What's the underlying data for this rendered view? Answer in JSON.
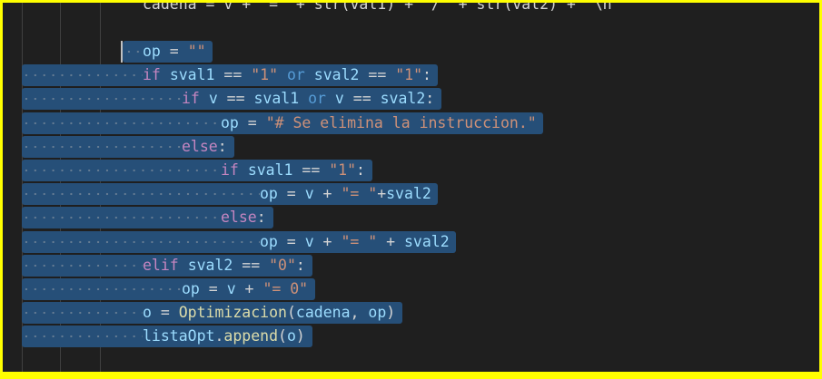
{
  "editor": {
    "top_partial": "cadena = v + \"=\" + str(val1) + \"/\" + str(val2) + \"\\n\"",
    "lines": [
      {
        "indent": 0,
        "tokens": [
          [
            "var",
            "op"
          ],
          [
            "plain",
            " = "
          ],
          [
            "str",
            "\"\""
          ]
        ]
      },
      {
        "indent": 0,
        "tokens": [
          [
            "kw-ctrl",
            "if"
          ],
          [
            "plain",
            " "
          ],
          [
            "var",
            "sval1"
          ],
          [
            "plain",
            " == "
          ],
          [
            "str",
            "\"1\""
          ],
          [
            "plain",
            " "
          ],
          [
            "kw-op",
            "or"
          ],
          [
            "plain",
            " "
          ],
          [
            "var",
            "sval2"
          ],
          [
            "plain",
            " == "
          ],
          [
            "str",
            "\"1\""
          ],
          [
            "plain",
            ":"
          ]
        ]
      },
      {
        "indent": 1,
        "tokens": [
          [
            "kw-ctrl",
            "if"
          ],
          [
            "plain",
            " "
          ],
          [
            "var",
            "v"
          ],
          [
            "plain",
            " == "
          ],
          [
            "var",
            "sval1"
          ],
          [
            "plain",
            " "
          ],
          [
            "kw-op",
            "or"
          ],
          [
            "plain",
            " "
          ],
          [
            "var",
            "v"
          ],
          [
            "plain",
            " == "
          ],
          [
            "var",
            "sval2"
          ],
          [
            "plain",
            ":"
          ]
        ]
      },
      {
        "indent": 2,
        "tokens": [
          [
            "var",
            "op"
          ],
          [
            "plain",
            " = "
          ],
          [
            "str",
            "\"# Se elimina la instruccion.\""
          ]
        ]
      },
      {
        "indent": 1,
        "tokens": [
          [
            "kw-ctrl",
            "else"
          ],
          [
            "plain",
            ":"
          ]
        ]
      },
      {
        "indent": 2,
        "tokens": [
          [
            "kw-ctrl",
            "if"
          ],
          [
            "plain",
            " "
          ],
          [
            "var",
            "sval1"
          ],
          [
            "plain",
            " == "
          ],
          [
            "str",
            "\"1\""
          ],
          [
            "plain",
            ":"
          ]
        ]
      },
      {
        "indent": 3,
        "tokens": [
          [
            "var",
            "op"
          ],
          [
            "plain",
            " = "
          ],
          [
            "var",
            "v"
          ],
          [
            "plain",
            " + "
          ],
          [
            "str",
            "\"= \""
          ],
          [
            "plain",
            "+"
          ],
          [
            "var",
            "sval2"
          ]
        ]
      },
      {
        "indent": 2,
        "tokens": [
          [
            "kw-ctrl",
            "else"
          ],
          [
            "plain",
            ":"
          ]
        ]
      },
      {
        "indent": 3,
        "tokens": [
          [
            "var",
            "op"
          ],
          [
            "plain",
            " = "
          ],
          [
            "var",
            "v"
          ],
          [
            "plain",
            " + "
          ],
          [
            "str",
            "\"= \""
          ],
          [
            "plain",
            " + "
          ],
          [
            "var",
            "sval2"
          ]
        ]
      },
      {
        "indent": 0,
        "tokens": [
          [
            "kw-ctrl",
            "elif"
          ],
          [
            "plain",
            " "
          ],
          [
            "var",
            "sval2"
          ],
          [
            "plain",
            " == "
          ],
          [
            "str",
            "\"0\""
          ],
          [
            "plain",
            ":"
          ]
        ]
      },
      {
        "indent": 1,
        "tokens": [
          [
            "var",
            "op"
          ],
          [
            "plain",
            " = "
          ],
          [
            "var",
            "v"
          ],
          [
            "plain",
            " + "
          ],
          [
            "str",
            "\"= 0\""
          ]
        ]
      },
      {
        "indent": 0,
        "tokens": [
          [
            "var",
            "o"
          ],
          [
            "plain",
            " = "
          ],
          [
            "fn",
            "Optimizacion"
          ],
          [
            "plain",
            "("
          ],
          [
            "var",
            "cadena"
          ],
          [
            "plain",
            ", "
          ],
          [
            "var",
            "op"
          ],
          [
            "plain",
            ")"
          ]
        ]
      },
      {
        "indent": 0,
        "tokens": [
          [
            "var",
            "listaOpt"
          ],
          [
            "plain",
            "."
          ],
          [
            "fn",
            "append"
          ],
          [
            "plain",
            "("
          ],
          [
            "var",
            "o"
          ],
          [
            "plain",
            ")"
          ]
        ]
      }
    ]
  }
}
